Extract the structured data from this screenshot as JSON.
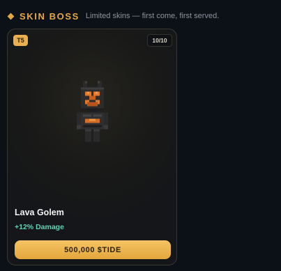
{
  "header": {
    "icon": "diamond-icon",
    "title": "SKIN BOSS",
    "subtitle": "Limited skins — first come, first served."
  },
  "card": {
    "tier": "T5",
    "stock": "10/10",
    "sprite": "lava-golem-sprite",
    "name": "Lava Golem",
    "bonus": "+12% Damage",
    "price_button": "500,000 $TIDE"
  },
  "colors": {
    "accent_gold": "#e5a844",
    "bonus_teal": "#5fd3b4",
    "lava_orange": "#e07b2e",
    "background": "#0c1118"
  }
}
